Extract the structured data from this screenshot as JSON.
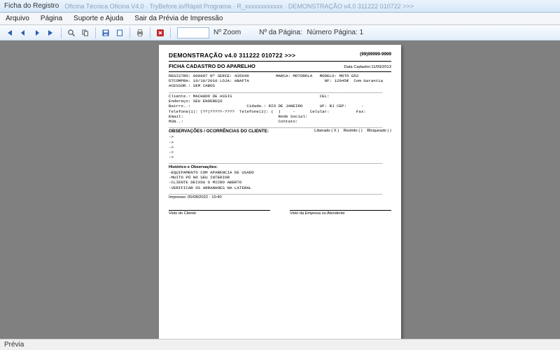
{
  "window": {
    "title": "Ficha do Registro",
    "title_dim": "Oficina Técnica Oficina V4.0 · TryBefore.io/Rápid Programa · R_xxxxxxxxxxxx · DEMONSTRAÇÃO v4.0 311222 010722 >>>"
  },
  "menu": {
    "arquivo": "Arquivo",
    "pagina": "Página",
    "suporte": "Suporte e Ajuda",
    "sair": "Sair da Prévia de Impressão"
  },
  "toolbar": {
    "zoom_label": "Nº Zoom",
    "page_label": "Nº da Página:",
    "page_value": "Número Página: 1"
  },
  "report": {
    "header_title": "DEMONSTRAÇÃO v4.0 311222 010722 >>>",
    "phone": "(99)99999-9999",
    "subtitle": "FICHA CADASTRO DO APARELHO",
    "data_cadastro_label": "Data Cadastro:",
    "data_cadastro": "11/09/2013",
    "reg_line": "REGISTRO: 000007 Nº SERIE: 435646           MARCA: MOTOROLA   MODELO: MOTO G52",
    "comp_line": "DTCOMPRA: 10/10/2010 LOJA: ABAFTA                               NF: 12045€  Com Garantia",
    "aces_line": "ACESSOR.: SEM CABOS",
    "cli_line": "Cliente.: MACHADO DE ASSIS                                    CEL:",
    "end_line": "Endereço: SEU ENDEREÇO",
    "bai_line": "Bairro..:                       Cidade.: RIO DE JANEIRO       UF: RJ CEP:      -",
    "tel_line": "Telefone(1): (??)?????-????  Telefone(2): (  )     -      Celular:           Fax:",
    "ema_line": "Email:                                       Rede Social:",
    "msn_line": "MSN..:                                       Contato:",
    "obs_title": "OBSERVAÇÕES / OCORRÊNCIAS DO CLIENTE:",
    "flag_liberado": "Liberado ( X )",
    "flag_restrito": "Restrito (   )",
    "flag_bloqueado": "Bloqueado (   )",
    "arrows": [
      "->",
      "->",
      "->",
      "->",
      "->"
    ],
    "hist_title": "Histórico e Observações:",
    "hist_lines": [
      "-EQUIPAMENTO COM APARENCIA DE USADO",
      "-MUITO PÓ NO SEU INTERIOR",
      "-CLIENTE DEIXOU O MICRO ABERTO",
      "-VERIFICAR OS ARRANHOES NA LATERAL"
    ],
    "impresso": "Impresso: 05/08/2022 - 10:40",
    "visto_cliente": "Visto do Cliente",
    "visto_empresa": "Visto da Empresa ou Atendente"
  },
  "status": {
    "text": "Prévia"
  }
}
